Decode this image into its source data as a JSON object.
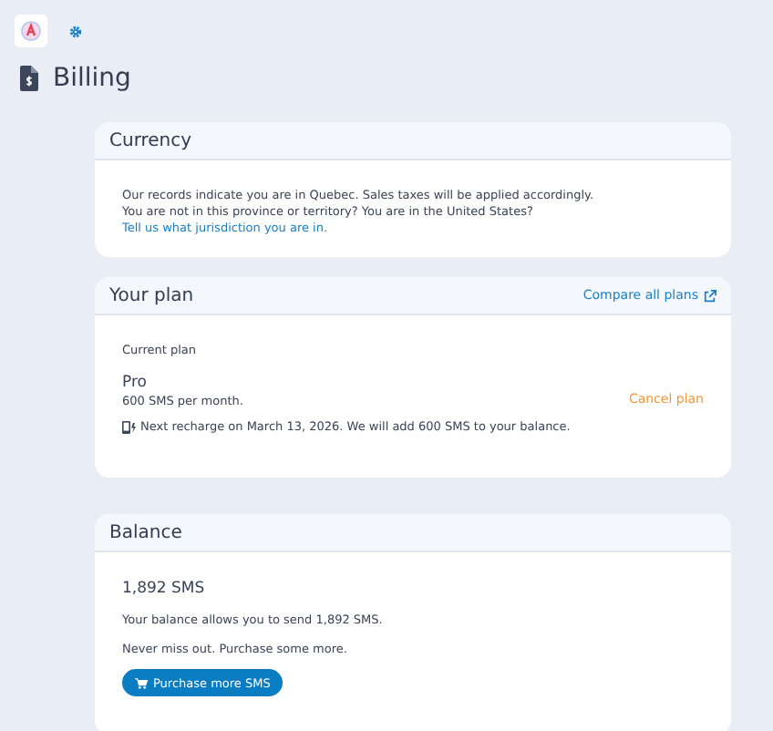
{
  "page": {
    "title": "Billing"
  },
  "currency": {
    "title": "Currency",
    "line_1": "Our records indicate you are in Quebec. Sales taxes will be applied accordingly.",
    "line_2": "You are not in this province or territory? You are in the United States?",
    "link": "Tell us what jurisdiction you are in."
  },
  "plan": {
    "title": "Your plan",
    "compare_link": "Compare all plans",
    "label": "Current plan",
    "name": "Pro",
    "description": "600 SMS per month.",
    "cancel": "Cancel plan",
    "recharge": "Next recharge on March 13, 2026. We will add 600 SMS to your balance."
  },
  "balance": {
    "title": "Balance",
    "amount": "1,892 SMS",
    "line_1": "Your balance allows you to send 1,892 SMS.",
    "line_2": "Never miss out. Purchase some more.",
    "button": "Purchase more SMS"
  }
}
